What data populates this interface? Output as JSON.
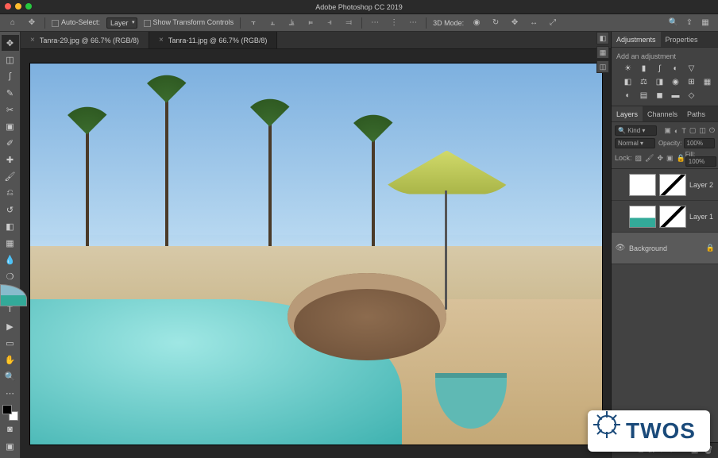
{
  "app_title": "Adobe Photoshop CC 2019",
  "options_bar": {
    "tool_icon": "move-tool",
    "auto_select_label": "Auto-Select:",
    "auto_select_value": "Layer",
    "show_transform_label": "Show Transform Controls",
    "mode_label": "3D Mode:"
  },
  "tabs": [
    {
      "label": "Tanra-29.jpg @ 66.7% (RGB/8)",
      "active": false
    },
    {
      "label": "Tanra-11.jpg @ 66.7% (RGB/8)",
      "active": true
    }
  ],
  "adjustments": {
    "tab_adjustments": "Adjustments",
    "tab_properties": "Properties",
    "heading": "Add an adjustment"
  },
  "layers_panel": {
    "tab_layers": "Layers",
    "tab_channels": "Channels",
    "tab_paths": "Paths",
    "kind_label": "Kind",
    "blend_mode": "Normal",
    "opacity_label": "Opacity:",
    "opacity_value": "100%",
    "lock_label": "Lock:",
    "fill_label": "Fill:",
    "fill_value": "100%",
    "layers": [
      {
        "name": "Layer 2",
        "visible": false,
        "locked": false,
        "selected": false,
        "has_mask": true
      },
      {
        "name": "Layer 1",
        "visible": false,
        "locked": false,
        "selected": false,
        "has_mask": true
      },
      {
        "name": "Background",
        "visible": true,
        "locked": true,
        "selected": true,
        "has_mask": false
      }
    ]
  },
  "logo_text": "TWOS"
}
